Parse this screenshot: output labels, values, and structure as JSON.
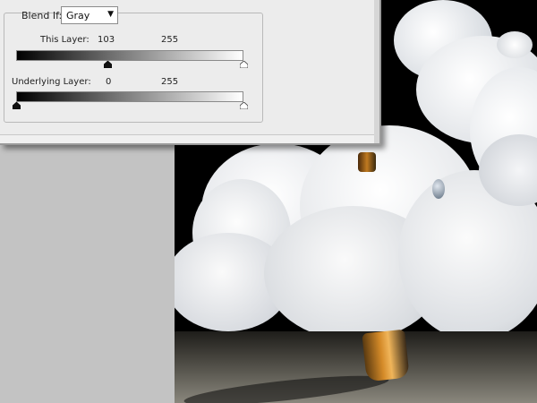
{
  "dialog": {
    "blend_if_label": "Blend If:",
    "blend_if_value": "Gray",
    "this_layer": {
      "label": "This Layer:",
      "black_value": "103",
      "white_value": "255",
      "black_fraction": 0.404,
      "white_fraction": 1.0
    },
    "underlying_layer": {
      "label": "Underlying Layer:",
      "black_value": "0",
      "white_value": "255",
      "black_fraction": 0.0,
      "white_fraction": 1.0
    }
  },
  "icons": {
    "dropdown": "chevron-down-icon",
    "black_slider": "slider-black-triangle-icon",
    "white_slider": "slider-white-triangle-icon"
  }
}
